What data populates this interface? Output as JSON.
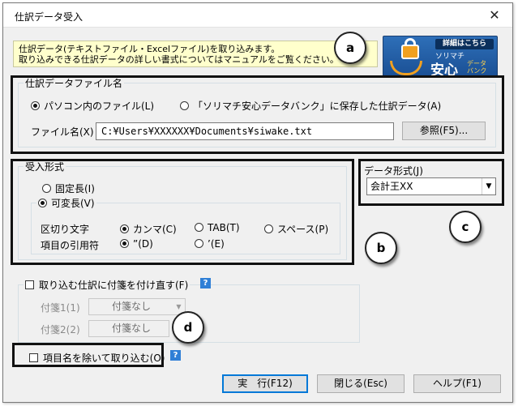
{
  "window": {
    "title": "仕訳データ受入",
    "close_glyph": "✕"
  },
  "info": {
    "line1": "仕訳データ(テキストファイル・Excelファイル)を取り込みます。",
    "line2": "取り込みできる仕訳データの詳しい書式についてはマニュアルをご覧ください。"
  },
  "banner": {
    "tag": "詳細はこちら",
    "line1": "ソリマチ",
    "line2": "安心",
    "line3": "データバンク"
  },
  "source": {
    "legend": "仕訳データファイル名",
    "option_local": "パソコン内のファイル(L)",
    "option_bank": "「ソリマチ安心データバンク」に保存した仕訳データ(A)",
    "selected": "local",
    "filename_label": "ファイル名(X)",
    "filename_value": "C:¥Users¥XXXXXX¥Documents¥siwake.txt",
    "browse_label": "参照(F5)..."
  },
  "format": {
    "legend": "受入形式",
    "fixed_label": "固定長(I)",
    "variable_label": "可変長(V)",
    "selected": "variable",
    "delimiter_label": "区切り文字",
    "delimiters": [
      "カンマ(C)",
      "TAB(T)",
      "スペース(P)"
    ],
    "delimiter_selected": 0,
    "quote_label": "項目の引用符",
    "quotes": [
      "”(D)",
      "’(E)"
    ],
    "quote_selected": 0
  },
  "data_format": {
    "label": "データ形式(J)",
    "value": "会計王XX"
  },
  "tags": {
    "checkbox_label": "取り込む仕訳に付箋を付け直す(F)",
    "tag1_label": "付箋1(1)",
    "tag1_value": "付箋なし",
    "tag2_label": "付箋2(2)",
    "tag2_value": "付箋なし",
    "help_glyph": "?"
  },
  "exclude_header": {
    "checkbox_label": "項目名を除いて取り込む(O)",
    "help_glyph": "?"
  },
  "footer": {
    "execute_label": "実　行(F12)",
    "close_label": "閉じる(Esc)",
    "help_label": "ヘルプ(F1)"
  },
  "callouts": [
    "a",
    "b",
    "c",
    "d"
  ]
}
